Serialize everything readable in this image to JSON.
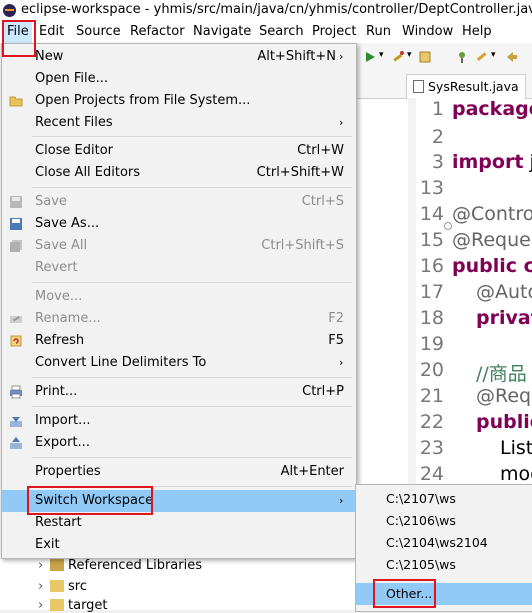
{
  "window": {
    "title": "eclipse-workspace - yhmis/src/main/java/cn/yhmis/controller/DeptController.java - Eclip"
  },
  "menubar": [
    "File",
    "Edit",
    "Source",
    "Refactor",
    "Navigate",
    "Search",
    "Project",
    "Run",
    "Window",
    "Help"
  ],
  "file_menu": {
    "new": {
      "label": "New",
      "shortcut": "Alt+Shift+N"
    },
    "open_file": {
      "label": "Open File..."
    },
    "open_projects": {
      "label": "Open Projects from File System..."
    },
    "recent_files": {
      "label": "Recent Files"
    },
    "close_editor": {
      "label": "Close Editor",
      "shortcut": "Ctrl+W"
    },
    "close_all_editors": {
      "label": "Close All Editors",
      "shortcut": "Ctrl+Shift+W"
    },
    "save": {
      "label": "Save",
      "shortcut": "Ctrl+S"
    },
    "save_as": {
      "label": "Save As..."
    },
    "save_all": {
      "label": "Save All",
      "shortcut": "Ctrl+Shift+S"
    },
    "revert": {
      "label": "Revert"
    },
    "move": {
      "label": "Move..."
    },
    "rename": {
      "label": "Rename...",
      "shortcut": "F2"
    },
    "refresh": {
      "label": "Refresh",
      "shortcut": "F5"
    },
    "convert": {
      "label": "Convert Line Delimiters To"
    },
    "print": {
      "label": "Print...",
      "shortcut": "Ctrl+P"
    },
    "import": {
      "label": "Import..."
    },
    "export": {
      "label": "Export..."
    },
    "properties": {
      "label": "Properties",
      "shortcut": "Alt+Enter"
    },
    "switch_workspace": {
      "label": "Switch Workspace"
    },
    "restart": {
      "label": "Restart"
    },
    "exit": {
      "label": "Exit"
    }
  },
  "switch_workspace_menu": [
    "C:\\2107\\ws",
    "C:\\2106\\ws",
    "C:\\2104\\ws2104",
    "C:\\2105\\ws",
    "Other..."
  ],
  "editor": {
    "tab": "SysResult.java",
    "line_numbers": [
      "1",
      "2",
      "3",
      "13",
      "14",
      "15",
      "16",
      "17",
      "18",
      "19",
      "20",
      "21",
      "22",
      "23",
      "24"
    ],
    "code": {
      "l1": "package",
      "l3a": "import",
      "l3b": " ja",
      "l14": "@Contro",
      "l15": "@Reques",
      "l16a": "public",
      "l16b": " cl",
      "l17": "@Auto",
      "l18": "privat",
      "l20": "//商品",
      "l21": "@Requ",
      "l22": "public",
      "l23": "List",
      "l24": "mod"
    }
  },
  "explorer": {
    "items": [
      "Referenced Libraries",
      "src",
      "target"
    ]
  },
  "colors": {
    "highlight": "#e0141e",
    "hover": "#91c9f7",
    "keyword": "#7f0055"
  }
}
